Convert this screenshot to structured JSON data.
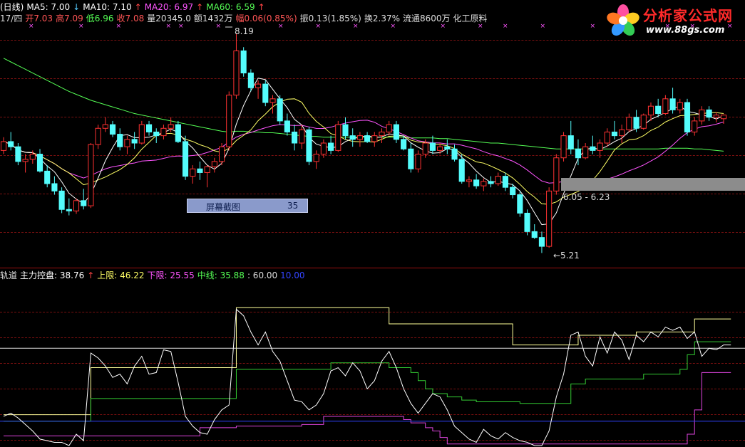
{
  "header_line1": [
    {
      "text": "(日线)",
      "color": "#ffffff"
    },
    {
      "text": "MA5: 7.00",
      "color": "#ffffff"
    },
    {
      "text": "↓",
      "color": "#55ccff"
    },
    {
      "text": "MA10: 7.10",
      "color": "#ffffff"
    },
    {
      "text": "↑",
      "color": "#ff4444"
    },
    {
      "text": "MA20: 6.97",
      "color": "#ff55ff"
    },
    {
      "text": "↑",
      "color": "#ff4444"
    },
    {
      "text": "MA60: 6.59",
      "color": "#55ff55"
    },
    {
      "text": "↑",
      "color": "#ff4444"
    }
  ],
  "header_line2": [
    {
      "text": "17/四",
      "color": "#dddddd"
    },
    {
      "text": "开7.03",
      "color": "#ff5555"
    },
    {
      "text": "高7.09",
      "color": "#ff5555"
    },
    {
      "text": "低6.96",
      "color": "#55ff55"
    },
    {
      "text": "收7.08",
      "color": "#ff5555"
    },
    {
      "text": "量20345.0",
      "color": "#dddddd"
    },
    {
      "text": "额1432万",
      "color": "#dddddd"
    },
    {
      "text": "幅0.06(0.85%)",
      "color": "#ff5555"
    },
    {
      "text": "振0.13(1.85%)",
      "color": "#dddddd"
    },
    {
      "text": "换2.37%",
      "color": "#dddddd"
    },
    {
      "text": "流通8600万",
      "color": "#dddddd"
    },
    {
      "text": "化工原料",
      "color": "#dddddd"
    }
  ],
  "logo": {
    "title": "分析家公式网",
    "url": "www.88gs.com"
  },
  "screenshot_box": {
    "label": "屏幕截图",
    "value": "35"
  },
  "annotations": {
    "high": "8.19",
    "low": "←5.21",
    "range": "6.05 - 6.23"
  },
  "indicator_header": [
    {
      "text": "轨道",
      "color": "#dddddd"
    },
    {
      "text": "主力控盘: 38.76",
      "color": "#ffffff"
    },
    {
      "text": "↑",
      "color": "#ff4444"
    },
    {
      "text": "上限: 46.22",
      "color": "#ffff66"
    },
    {
      "text": "下限: 25.55",
      "color": "#ff55ff"
    },
    {
      "text": "中线: 35.88",
      "color": "#55ff55"
    },
    {
      "text": ": 60.00",
      "color": "#dddddd"
    },
    {
      "text": "10.00",
      "color": "#3344ff"
    }
  ],
  "colors": {
    "up": "#ff3232",
    "down": "#54fcfc",
    "ma5": "#ffffff",
    "ma10": "#ffff66",
    "ma20": "#ff55ff",
    "ma60": "#55ff55",
    "grid": "#7a1010"
  },
  "chart_data": {
    "type": "candlestick",
    "candles": [
      [
        6.6,
        6.78,
        6.55,
        6.72
      ],
      [
        6.72,
        6.85,
        6.6,
        6.65
      ],
      [
        6.65,
        6.7,
        6.4,
        6.45
      ],
      [
        6.45,
        6.55,
        6.3,
        6.48
      ],
      [
        6.48,
        6.6,
        6.42,
        6.55
      ],
      [
        6.55,
        6.62,
        6.3,
        6.32
      ],
      [
        6.32,
        6.4,
        6.1,
        6.15
      ],
      [
        6.15,
        6.25,
        6.0,
        6.05
      ],
      [
        6.05,
        6.1,
        5.75,
        5.8
      ],
      [
        5.8,
        5.95,
        5.72,
        5.78
      ],
      [
        5.78,
        5.95,
        5.74,
        5.92
      ],
      [
        5.92,
        6.08,
        5.8,
        5.85
      ],
      [
        5.85,
        6.7,
        5.82,
        6.68
      ],
      [
        6.68,
        6.95,
        6.62,
        6.9
      ],
      [
        6.9,
        7.05,
        6.85,
        6.95
      ],
      [
        6.95,
        7.0,
        6.78,
        6.82
      ],
      [
        6.82,
        6.9,
        6.6,
        6.65
      ],
      [
        6.65,
        6.8,
        6.55,
        6.75
      ],
      [
        6.75,
        6.85,
        6.62,
        6.7
      ],
      [
        6.7,
        7.0,
        6.68,
        6.95
      ],
      [
        6.95,
        7.0,
        6.8,
        6.85
      ],
      [
        6.85,
        6.9,
        6.7,
        6.8
      ],
      [
        6.8,
        6.95,
        6.75,
        6.9
      ],
      [
        6.9,
        7.05,
        6.85,
        6.95
      ],
      [
        6.95,
        7.0,
        6.7,
        6.72
      ],
      [
        6.72,
        6.8,
        6.2,
        6.25
      ],
      [
        6.25,
        6.4,
        6.15,
        6.35
      ],
      [
        6.35,
        6.45,
        6.2,
        6.3
      ],
      [
        6.3,
        6.4,
        6.1,
        6.38
      ],
      [
        6.38,
        6.5,
        6.3,
        6.45
      ],
      [
        6.45,
        6.7,
        6.4,
        6.65
      ],
      [
        6.65,
        7.4,
        6.6,
        7.35
      ],
      [
        7.35,
        8.19,
        7.3,
        7.95
      ],
      [
        7.95,
        8.0,
        7.6,
        7.65
      ],
      [
        7.65,
        7.7,
        7.4,
        7.45
      ],
      [
        7.45,
        7.55,
        7.3,
        7.5
      ],
      [
        7.5,
        7.55,
        7.2,
        7.25
      ],
      [
        7.25,
        7.35,
        7.1,
        7.3
      ],
      [
        7.3,
        7.35,
        6.95,
        7.0
      ],
      [
        7.0,
        7.1,
        6.8,
        6.85
      ],
      [
        6.85,
        6.95,
        6.6,
        6.7
      ],
      [
        6.7,
        6.95,
        6.62,
        6.88
      ],
      [
        6.88,
        6.92,
        6.4,
        6.45
      ],
      [
        6.45,
        6.6,
        6.35,
        6.55
      ],
      [
        6.55,
        6.75,
        6.5,
        6.7
      ],
      [
        6.7,
        6.8,
        6.55,
        6.6
      ],
      [
        6.6,
        7.0,
        6.58,
        6.95
      ],
      [
        6.95,
        7.05,
        6.75,
        6.8
      ],
      [
        6.8,
        6.9,
        6.65,
        6.75
      ],
      [
        6.75,
        6.85,
        6.65,
        6.8
      ],
      [
        6.8,
        6.85,
        6.7,
        6.72
      ],
      [
        6.72,
        6.85,
        6.65,
        6.8
      ],
      [
        6.8,
        6.9,
        6.7,
        6.85
      ],
      [
        6.85,
        7.0,
        6.8,
        6.95
      ],
      [
        6.95,
        7.0,
        6.7,
        6.75
      ],
      [
        6.75,
        6.8,
        6.6,
        6.62
      ],
      [
        6.62,
        6.7,
        6.3,
        6.35
      ],
      [
        6.35,
        6.6,
        6.3,
        6.55
      ],
      [
        6.55,
        6.75,
        6.5,
        6.7
      ],
      [
        6.7,
        6.8,
        6.55,
        6.6
      ],
      [
        6.6,
        6.7,
        6.55,
        6.65
      ],
      [
        6.65,
        6.75,
        6.55,
        6.62
      ],
      [
        6.62,
        6.68,
        6.45,
        6.48
      ],
      [
        6.48,
        6.55,
        6.15,
        6.18
      ],
      [
        6.18,
        6.25,
        6.1,
        6.2
      ],
      [
        6.2,
        6.28,
        6.08,
        6.12
      ],
      [
        6.12,
        6.22,
        6.05,
        6.18
      ],
      [
        6.18,
        6.25,
        6.1,
        6.15
      ],
      [
        6.15,
        6.3,
        6.12,
        6.25
      ],
      [
        6.25,
        6.3,
        6.05,
        6.1
      ],
      [
        6.1,
        6.15,
        5.95,
        6.0
      ],
      [
        6.0,
        6.05,
        5.7,
        5.75
      ],
      [
        5.75,
        5.8,
        5.45,
        5.5
      ],
      [
        5.5,
        5.6,
        5.4,
        5.42
      ],
      [
        5.42,
        5.5,
        5.21,
        5.3
      ],
      [
        5.3,
        6.1,
        5.28,
        6.05
      ],
      [
        6.05,
        6.55,
        6.0,
        6.5
      ],
      [
        6.5,
        6.85,
        6.45,
        6.8
      ],
      [
        6.8,
        7.0,
        6.55,
        6.62
      ],
      [
        6.62,
        6.75,
        6.4,
        6.5
      ],
      [
        6.5,
        6.7,
        6.48,
        6.65
      ],
      [
        6.65,
        6.8,
        6.55,
        6.6
      ],
      [
        6.6,
        6.75,
        6.5,
        6.7
      ],
      [
        6.7,
        6.9,
        6.65,
        6.85
      ],
      [
        6.85,
        7.0,
        6.75,
        6.8
      ],
      [
        6.8,
        6.95,
        6.7,
        6.88
      ],
      [
        6.88,
        7.1,
        6.85,
        7.05
      ],
      [
        7.05,
        7.15,
        6.85,
        6.9
      ],
      [
        6.9,
        7.1,
        6.88,
        7.08
      ],
      [
        7.08,
        7.25,
        7.0,
        7.2
      ],
      [
        7.2,
        7.3,
        7.05,
        7.1
      ],
      [
        7.1,
        7.35,
        7.08,
        7.3
      ],
      [
        7.3,
        7.45,
        7.1,
        7.15
      ],
      [
        7.15,
        7.3,
        7.1,
        7.25
      ],
      [
        7.25,
        7.3,
        6.8,
        6.85
      ],
      [
        6.85,
        7.05,
        6.8,
        7.0
      ],
      [
        7.0,
        7.2,
        6.95,
        7.15
      ],
      [
        7.15,
        7.2,
        7.0,
        7.05
      ],
      [
        7.05,
        7.12,
        6.98,
        7.08
      ],
      [
        7.03,
        7.09,
        6.96,
        7.08
      ]
    ],
    "ma60": [
      7.85,
      7.8,
      7.75,
      7.7,
      7.65,
      7.6,
      7.55,
      7.5,
      7.45,
      7.4,
      7.36,
      7.32,
      7.28,
      7.25,
      7.22,
      7.19,
      7.16,
      7.13,
      7.1,
      7.08,
      7.06,
      7.04,
      7.02,
      7.0,
      6.98,
      6.96,
      6.94,
      6.92,
      6.9,
      6.88,
      6.86,
      6.85,
      6.86,
      6.86,
      6.85,
      6.85,
      6.84,
      6.84,
      6.83,
      6.82,
      6.81,
      6.8,
      6.79,
      6.79,
      6.78,
      6.78,
      6.78,
      6.78,
      6.78,
      6.78,
      6.78,
      6.78,
      6.78,
      6.78,
      6.78,
      6.78,
      6.77,
      6.77,
      6.77,
      6.77,
      6.76,
      6.76,
      6.75,
      6.74,
      6.73,
      6.72,
      6.71,
      6.7,
      6.7,
      6.69,
      6.68,
      6.67,
      6.66,
      6.65,
      6.64,
      6.63,
      6.62,
      6.62,
      6.62,
      6.62,
      6.62,
      6.62,
      6.62,
      6.62,
      6.62,
      6.62,
      6.62,
      6.62,
      6.62,
      6.62,
      6.62,
      6.63,
      6.63,
      6.63,
      6.63,
      6.62,
      6.62,
      6.61,
      6.6,
      6.59
    ],
    "indicator": {
      "ylim": [
        0,
        100
      ],
      "upper": [
        19,
        19,
        19,
        19,
        19,
        19,
        19,
        19,
        19,
        19,
        19,
        19,
        48,
        48,
        48,
        48,
        48,
        48,
        48,
        48,
        48,
        48,
        48,
        48,
        48,
        48,
        48,
        48,
        48,
        48,
        48,
        48,
        85,
        85,
        85,
        85,
        85,
        85,
        85,
        85,
        85,
        85,
        85,
        85,
        85,
        85,
        85,
        85,
        85,
        85,
        85,
        85,
        85,
        75,
        75,
        75,
        75,
        75,
        75,
        75,
        75,
        75,
        75,
        75,
        75,
        75,
        75,
        75,
        75,
        75,
        62,
        62,
        62,
        62,
        62,
        62,
        62,
        62,
        62,
        68,
        68,
        68,
        68,
        68,
        68,
        68,
        68,
        70,
        70,
        70,
        70,
        70,
        70,
        70,
        70,
        78,
        78,
        78,
        78,
        78,
        78
      ],
      "middle": [
        15,
        15,
        15,
        15,
        15,
        15,
        15,
        15,
        15,
        15,
        15,
        15,
        29,
        29,
        29,
        29,
        29,
        29,
        29,
        29,
        29,
        29,
        29,
        29,
        29,
        29,
        29,
        29,
        29,
        29,
        29,
        29,
        47,
        47,
        47,
        47,
        47,
        47,
        47,
        47,
        47,
        47,
        47,
        47,
        47,
        51,
        51,
        51,
        51,
        51,
        51,
        51,
        51,
        48,
        48,
        48,
        45,
        40,
        35,
        32,
        32,
        30,
        30,
        28,
        28,
        27,
        27,
        27,
        27,
        27,
        27,
        26,
        26,
        26,
        26,
        26,
        26,
        26,
        38,
        38,
        41,
        41,
        41,
        41,
        41,
        41,
        41,
        41,
        44,
        44,
        44,
        44,
        44,
        47,
        56,
        64,
        64,
        64,
        64,
        64,
        64
      ],
      "lower": [
        6,
        6,
        6,
        6,
        6,
        6,
        6,
        6,
        6,
        6,
        6,
        6,
        6,
        6,
        6,
        6,
        6,
        6,
        6,
        6,
        6,
        6,
        6,
        6,
        6,
        6,
        6,
        11,
        11,
        11,
        11,
        11,
        12,
        12,
        12,
        12,
        12,
        12,
        12,
        12,
        12,
        13,
        13,
        13,
        18,
        18,
        18,
        18,
        18,
        18,
        18,
        18,
        18,
        18,
        18,
        16,
        14,
        14,
        11,
        9,
        5,
        1,
        1,
        1,
        1,
        1,
        1,
        1,
        1,
        1,
        1,
        1,
        1,
        1,
        1,
        1,
        1,
        1,
        1,
        1,
        1,
        1,
        1,
        1,
        1,
        1,
        1,
        1,
        1,
        1,
        1,
        1,
        1,
        1,
        7,
        22,
        45,
        45,
        45,
        45,
        45
      ],
      "control": [
        18,
        20,
        17,
        13,
        9,
        4,
        3,
        2,
        2,
        0,
        7,
        3,
        57,
        54,
        49,
        42,
        44,
        38,
        49,
        55,
        44,
        45,
        59,
        58,
        39,
        18,
        12,
        8,
        7,
        16,
        22,
        25,
        84,
        80,
        70,
        62,
        70,
        58,
        52,
        40,
        28,
        27,
        22,
        25,
        32,
        46,
        48,
        43,
        51,
        46,
        35,
        40,
        52,
        58,
        48,
        35,
        26,
        20,
        26,
        32,
        30,
        22,
        12,
        8,
        4,
        2,
        10,
        6,
        4,
        8,
        5,
        3,
        2,
        0,
        0,
        9,
        30,
        44,
        68,
        70,
        55,
        49,
        67,
        57,
        70,
        65,
        53,
        68,
        64,
        70,
        67,
        73,
        71,
        73,
        66,
        70,
        55,
        60,
        59,
        62,
        62
      ]
    }
  }
}
